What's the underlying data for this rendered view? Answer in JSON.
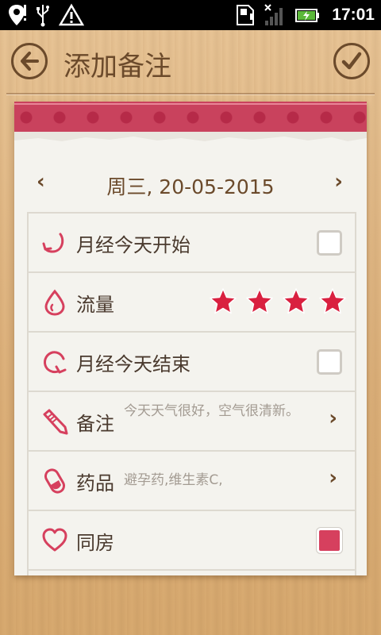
{
  "status_bar": {
    "time": "17:01",
    "icons": [
      "location-icon",
      "usb-icon",
      "warning-icon",
      "sd-card-icon",
      "signal-icon",
      "battery-charging-icon"
    ]
  },
  "header": {
    "title": "添加备注",
    "back_icon": "back-arrow-icon",
    "confirm_icon": "check-icon"
  },
  "date_nav": {
    "prev": "‹",
    "date": "周三, 20-05-2015",
    "next": "›"
  },
  "rows": [
    {
      "id": "period-start",
      "label": "月经今天开始",
      "icon": "period-start-icon",
      "control": "checkbox",
      "checked": false
    },
    {
      "id": "flow",
      "label": "流量",
      "icon": "drop-icon",
      "control": "stars",
      "rating": 4,
      "max": 4
    },
    {
      "id": "period-end",
      "label": "月经今天结束",
      "icon": "period-end-icon",
      "control": "checkbox",
      "checked": false
    },
    {
      "id": "note",
      "label": "备注",
      "icon": "pencil-icon",
      "control": "chevron",
      "value": "今天天气很好，空气很清新。"
    },
    {
      "id": "medicine",
      "label": "药品",
      "icon": "pill-icon",
      "control": "chevron",
      "value": "避孕药,维生素C,"
    },
    {
      "id": "intimacy",
      "label": "同房",
      "icon": "heart-icon",
      "control": "checkbox",
      "checked": true
    }
  ],
  "colors": {
    "accent": "#d6405e",
    "text_brown": "#6b4a2b",
    "paper": "#f4f3ee",
    "wood": "#dcb07a"
  },
  "chevron": "›"
}
